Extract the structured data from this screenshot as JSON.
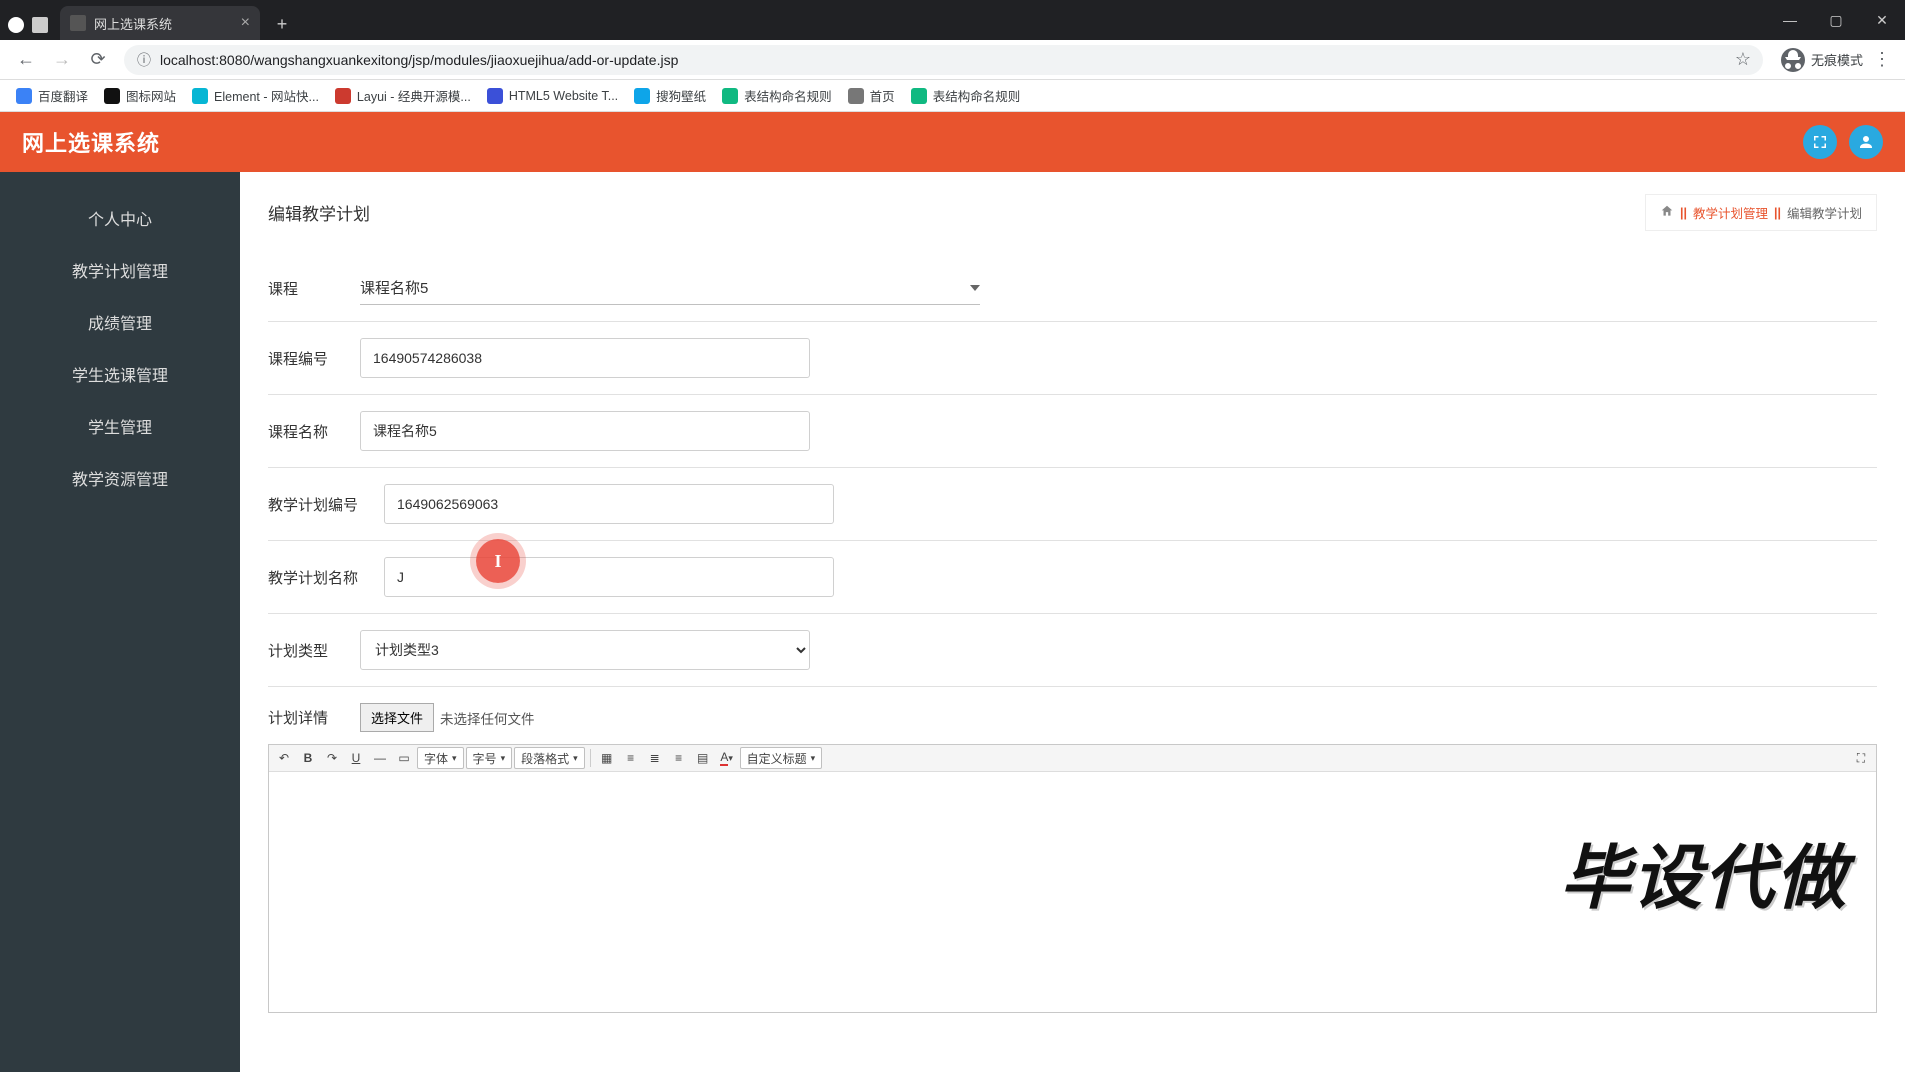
{
  "browser": {
    "tab_title": "网上选课系统",
    "url": "localhost:8080/wangshangxuankexitong/jsp/modules/jiaoxuejihua/add-or-update.jsp",
    "incognito_label": "无痕模式",
    "bookmarks": [
      {
        "label": "百度翻译",
        "color": "#3b82f6"
      },
      {
        "label": "图标网站",
        "color": "#111"
      },
      {
        "label": "Element - 网站快...",
        "color": "#06b6d4"
      },
      {
        "label": "Layui - 经典开源模...",
        "color": "#cc3a2f"
      },
      {
        "label": "HTML5 Website T...",
        "color": "#3b50d8"
      },
      {
        "label": "搜狗壁纸",
        "color": "#0ea5e9"
      },
      {
        "label": "表结构命名规则",
        "color": "#10b981"
      },
      {
        "label": "首页",
        "color": "#777"
      },
      {
        "label": "表结构命名规则",
        "color": "#10b981"
      }
    ]
  },
  "app": {
    "title": "网上选课系统"
  },
  "sidebar": {
    "items": [
      {
        "label": "个人中心"
      },
      {
        "label": "教学计划管理"
      },
      {
        "label": "成绩管理"
      },
      {
        "label": "学生选课管理"
      },
      {
        "label": "学生管理"
      },
      {
        "label": "教学资源管理"
      }
    ]
  },
  "page": {
    "title": "编辑教学计划",
    "breadcrumb": {
      "parent": "教学计划管理",
      "current": "编辑教学计划"
    }
  },
  "form": {
    "course_label": "课程",
    "course_selected": "课程名称5",
    "course_code_label": "课程编号",
    "course_code_value": "16490574286038",
    "course_name_label": "课程名称",
    "course_name_value": "课程名称5",
    "plan_code_label": "教学计划编号",
    "plan_code_value": "1649062569063",
    "plan_name_label": "教学计划名称",
    "plan_name_value": "J",
    "plan_type_label": "计划类型",
    "plan_type_value": "计划类型3",
    "plan_detail_label": "计划详情",
    "file_button": "选择文件",
    "file_status": "未选择任何文件"
  },
  "editor": {
    "font_label": "字体",
    "size_label": "字号",
    "paragraph_label": "段落格式",
    "custom_label": "自定义标题",
    "overlay_text": "毕设代做"
  }
}
